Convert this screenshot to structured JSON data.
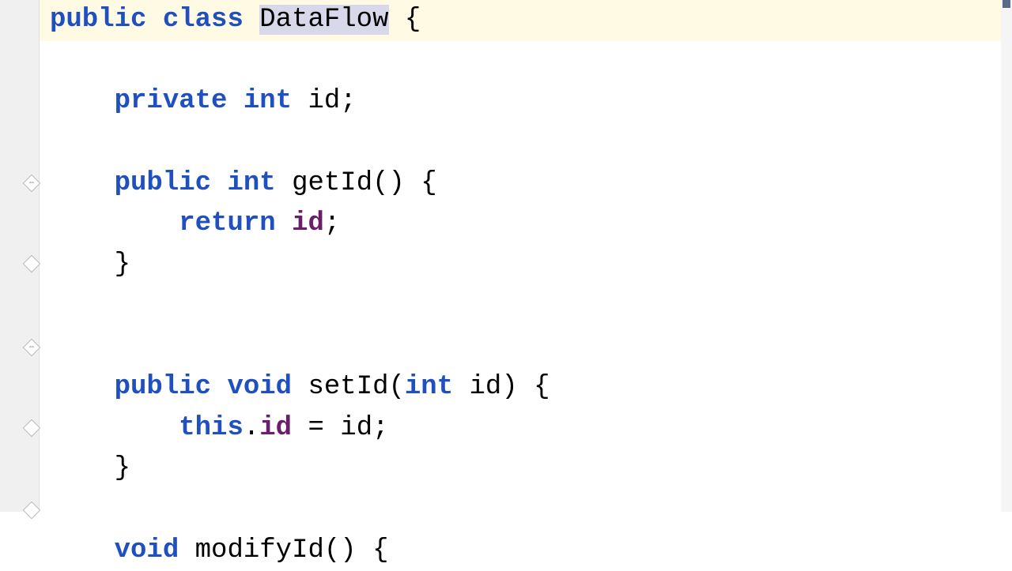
{
  "code": {
    "line1": {
      "kw1": "public",
      "kw2": "class",
      "classname": "DataFlow",
      "brace": " {"
    },
    "line2": "",
    "line3": {
      "indent": "    ",
      "kw1": "private",
      "type": "int",
      "field": "id",
      "semi": ";"
    },
    "line4": "",
    "line5": {
      "indent": "    ",
      "kw1": "public",
      "type": "int",
      "method": "getId() {",
      "methodname": "getId"
    },
    "line6": {
      "indent": "        ",
      "kw": "return",
      "field": "id",
      "semi": ";"
    },
    "line7": {
      "indent": "    ",
      "brace": "}"
    },
    "line8": "",
    "line9": "",
    "line10": {
      "indent": "    ",
      "kw1": "public",
      "kw2": "void",
      "method": "setId(",
      "type": "int",
      "param": " id) {"
    },
    "line11": {
      "indent": "        ",
      "thiskw": "this",
      "dot": ".",
      "field": "id",
      "eq": " = id;"
    },
    "line12": {
      "indent": "    ",
      "brace": "}"
    },
    "line13": "",
    "line14": {
      "indent": "    ",
      "kw": "void",
      "method": " modifyId() {"
    }
  }
}
